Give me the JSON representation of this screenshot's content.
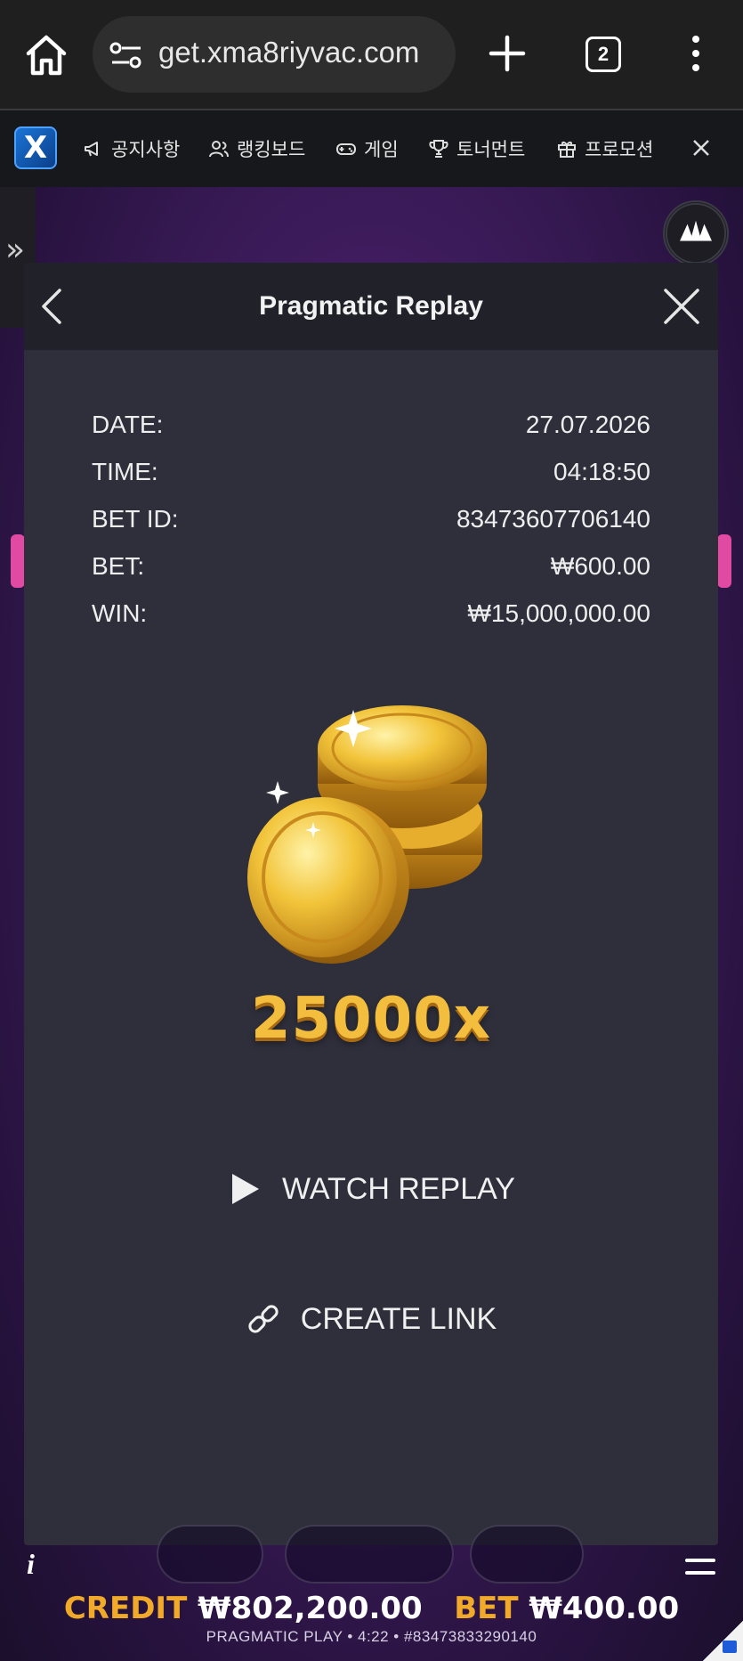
{
  "browser": {
    "url": "get.xma8riyvac.com",
    "tab_count": "2"
  },
  "site_nav": {
    "items": [
      {
        "label": "공지사항",
        "icon": "megaphone-icon"
      },
      {
        "label": "랭킹보드",
        "icon": "users-icon"
      },
      {
        "label": "게임",
        "icon": "gamepad-icon"
      },
      {
        "label": "토너먼트",
        "icon": "trophy-icon"
      },
      {
        "label": "프로모션",
        "icon": "gift-icon"
      }
    ]
  },
  "modal": {
    "title": "Pragmatic Replay",
    "details": [
      {
        "label": "DATE:",
        "value": "27.07.2026"
      },
      {
        "label": "TIME:",
        "value": "04:18:50"
      },
      {
        "label": "BET ID:",
        "value": "83473607706140"
      },
      {
        "label": "BET:",
        "value": "₩600.00"
      },
      {
        "label": "WIN:",
        "value": "₩15,000,000.00"
      }
    ],
    "multiplier": "25000x",
    "watch_replay_label": "WATCH REPLAY",
    "create_link_label": "CREATE LINK"
  },
  "game_bar": {
    "info_label": "i",
    "credit_label": "CREDIT",
    "credit_value": "₩802,200.00",
    "bet_label": "BET",
    "bet_value": "₩400.00",
    "footer": "PRAGMATIC PLAY • 4:22 • #83473833290140"
  },
  "colors": {
    "accent_gold": "#f3bd3d",
    "modal_bg": "#2e2f3b",
    "modal_header": "#202129"
  }
}
